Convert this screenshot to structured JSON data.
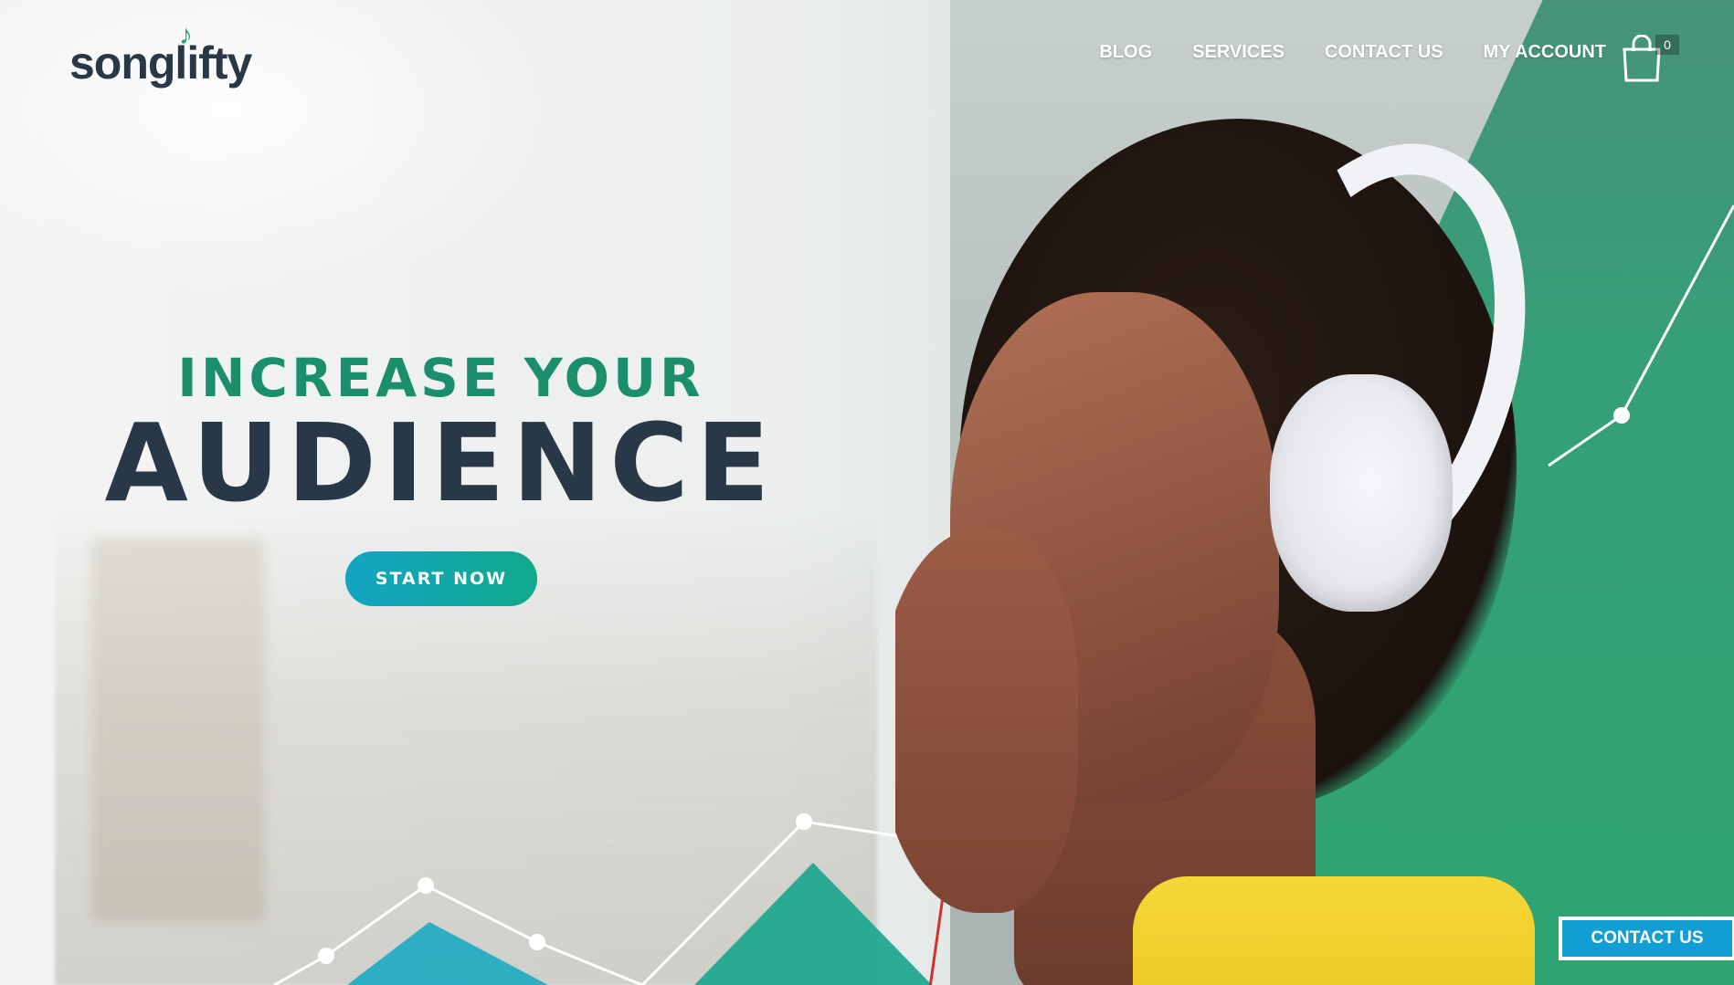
{
  "brand": {
    "logo_text": "songlifty",
    "logo_note_icon": "music-note-icon",
    "accent_green": "#1b8f6c",
    "accent_blue": "#13a4c4",
    "dark": "#283847"
  },
  "nav": {
    "items": [
      {
        "label": "BLOG"
      },
      {
        "label": "SERVICES"
      },
      {
        "label": "CONTACT US"
      },
      {
        "label": "MY ACCOUNT"
      }
    ],
    "cart_icon": "shopping-bag-icon",
    "cart_count": "0"
  },
  "hero": {
    "kicker": "INCREASE YOUR",
    "headline": "AUDIENCE",
    "cta_label": "START NOW"
  },
  "floating_contact": {
    "label": "CONTACT US"
  }
}
